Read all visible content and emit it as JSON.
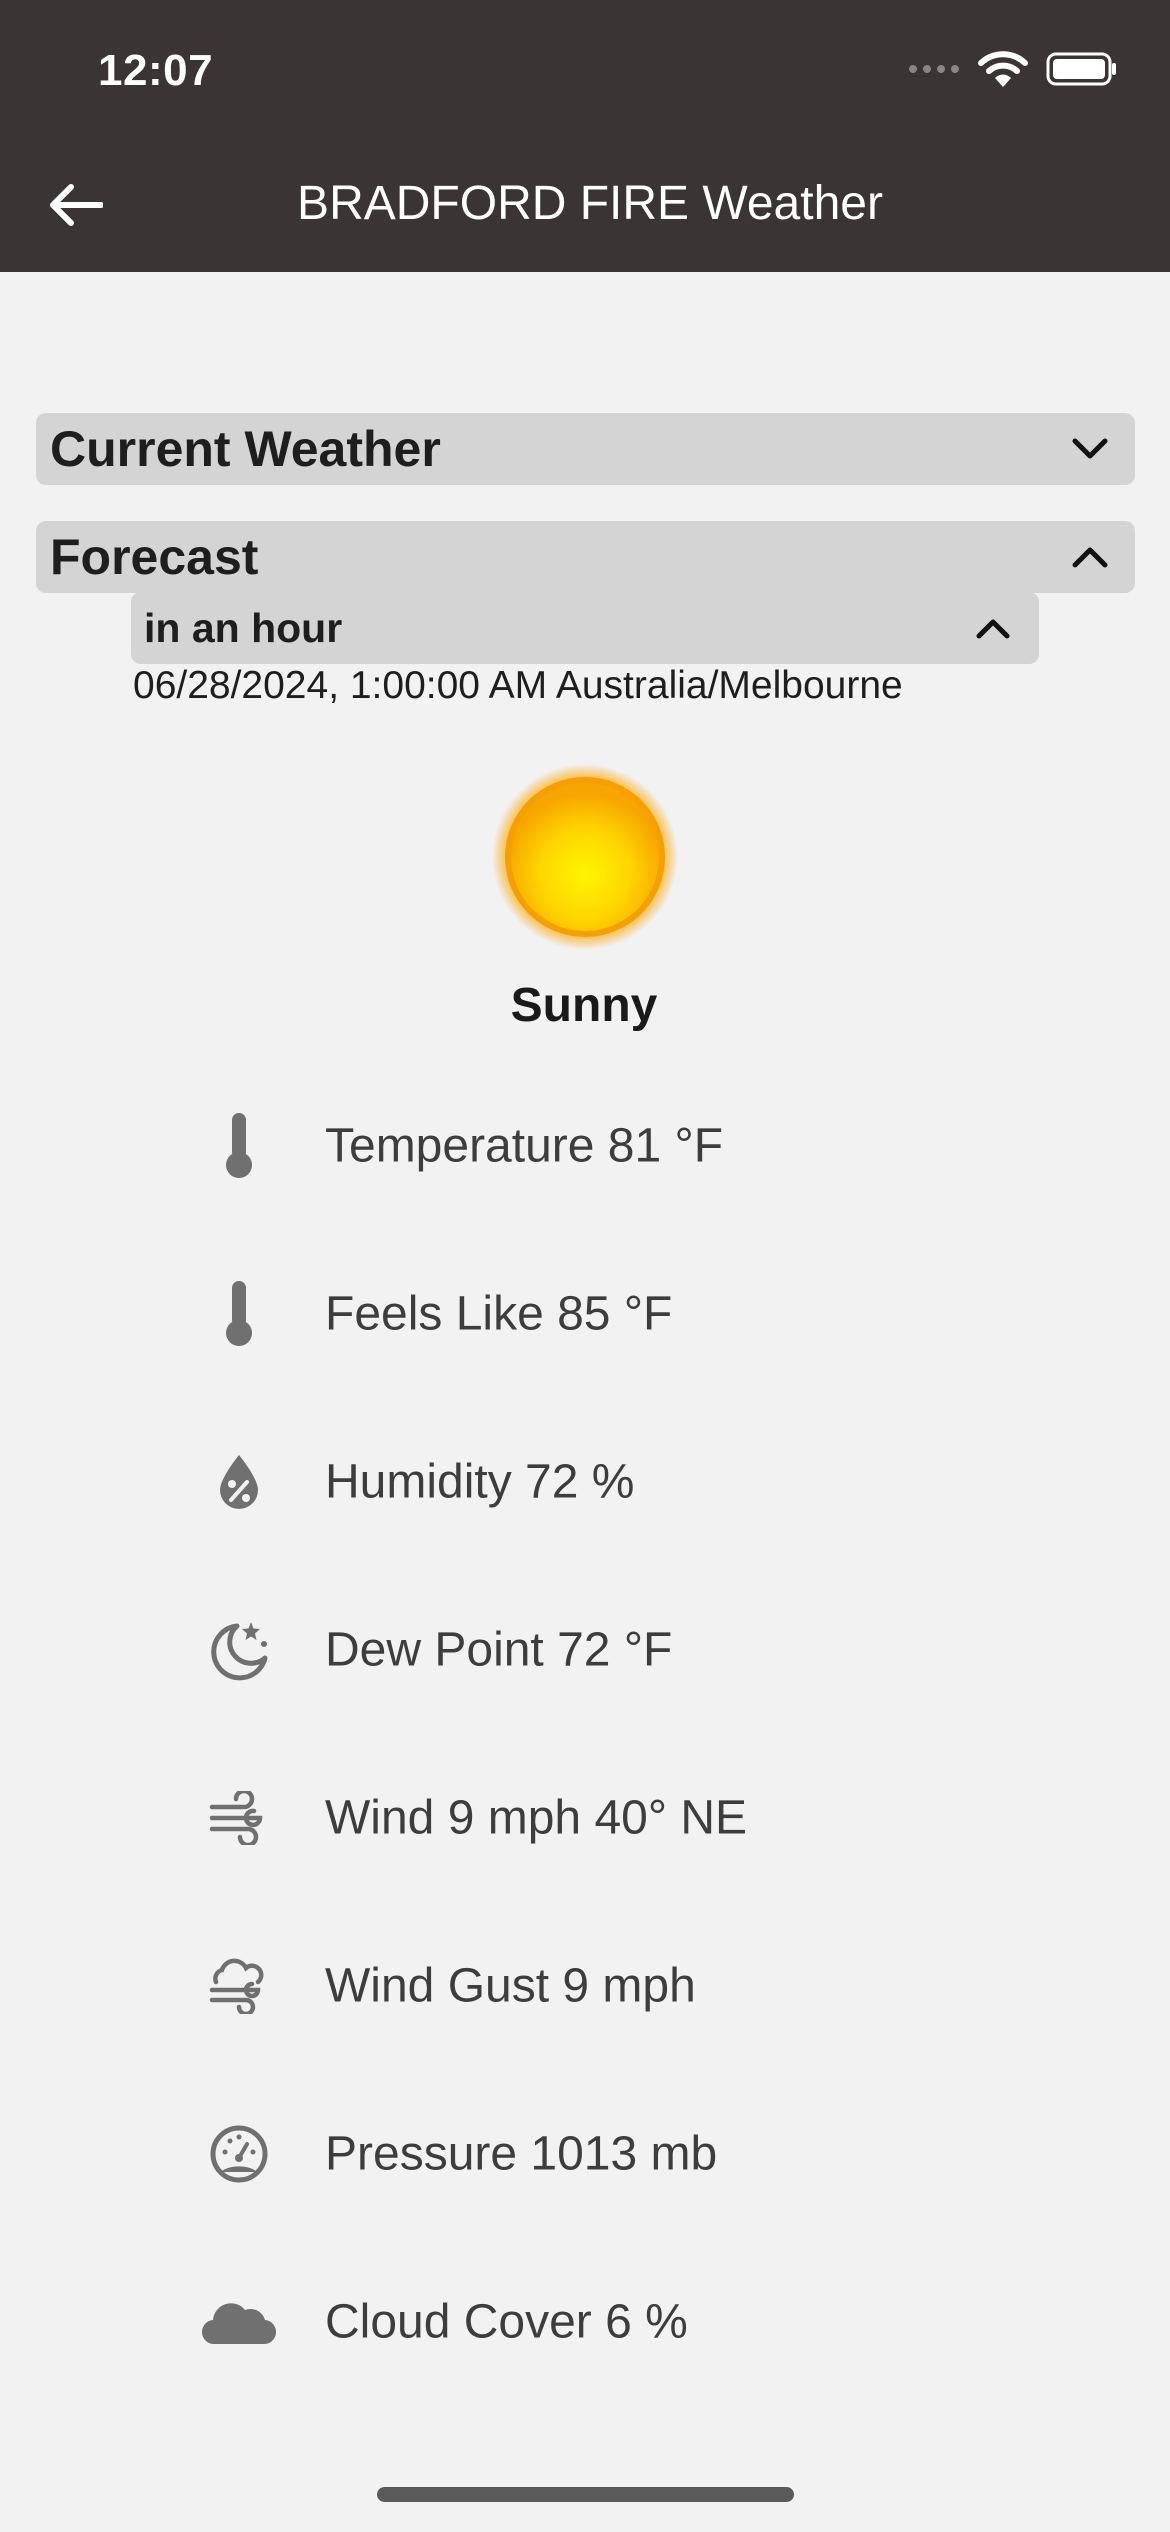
{
  "status_bar": {
    "time": "12:07"
  },
  "nav": {
    "title": "BRADFORD FIRE Weather",
    "back_icon": "arrow-left-icon"
  },
  "sections": {
    "current_weather": {
      "title": "Current Weather",
      "state": "collapsed"
    },
    "forecast": {
      "title": "Forecast",
      "state": "expanded"
    }
  },
  "forecast": {
    "period": {
      "title": "in an hour",
      "state": "expanded"
    },
    "datetime": "06/28/2024, 1:00:00 AM Australia/Melbourne",
    "condition": "Sunny",
    "condition_icon": "sun-icon",
    "details": [
      {
        "icon": "thermometer-icon",
        "label": "Temperature 81 °F"
      },
      {
        "icon": "thermometer-icon",
        "label": "Feels Like 85 °F"
      },
      {
        "icon": "humidity-icon",
        "label": "Humidity 72 %"
      },
      {
        "icon": "moon-star-icon",
        "label": "Dew Point 72 °F"
      },
      {
        "icon": "wind-icon",
        "label": "Wind 9 mph 40° NE"
      },
      {
        "icon": "wind-gust-icon",
        "label": "Wind Gust 9 mph"
      },
      {
        "icon": "gauge-icon",
        "label": "Pressure 1013 mb"
      },
      {
        "icon": "cloud-icon",
        "label": "Cloud Cover 6 %"
      }
    ]
  },
  "colors": {
    "header_bg": "#3a3434",
    "section_bg": "#d4d4d4",
    "page_bg": "#f2f2f2",
    "icon": "#707070"
  }
}
